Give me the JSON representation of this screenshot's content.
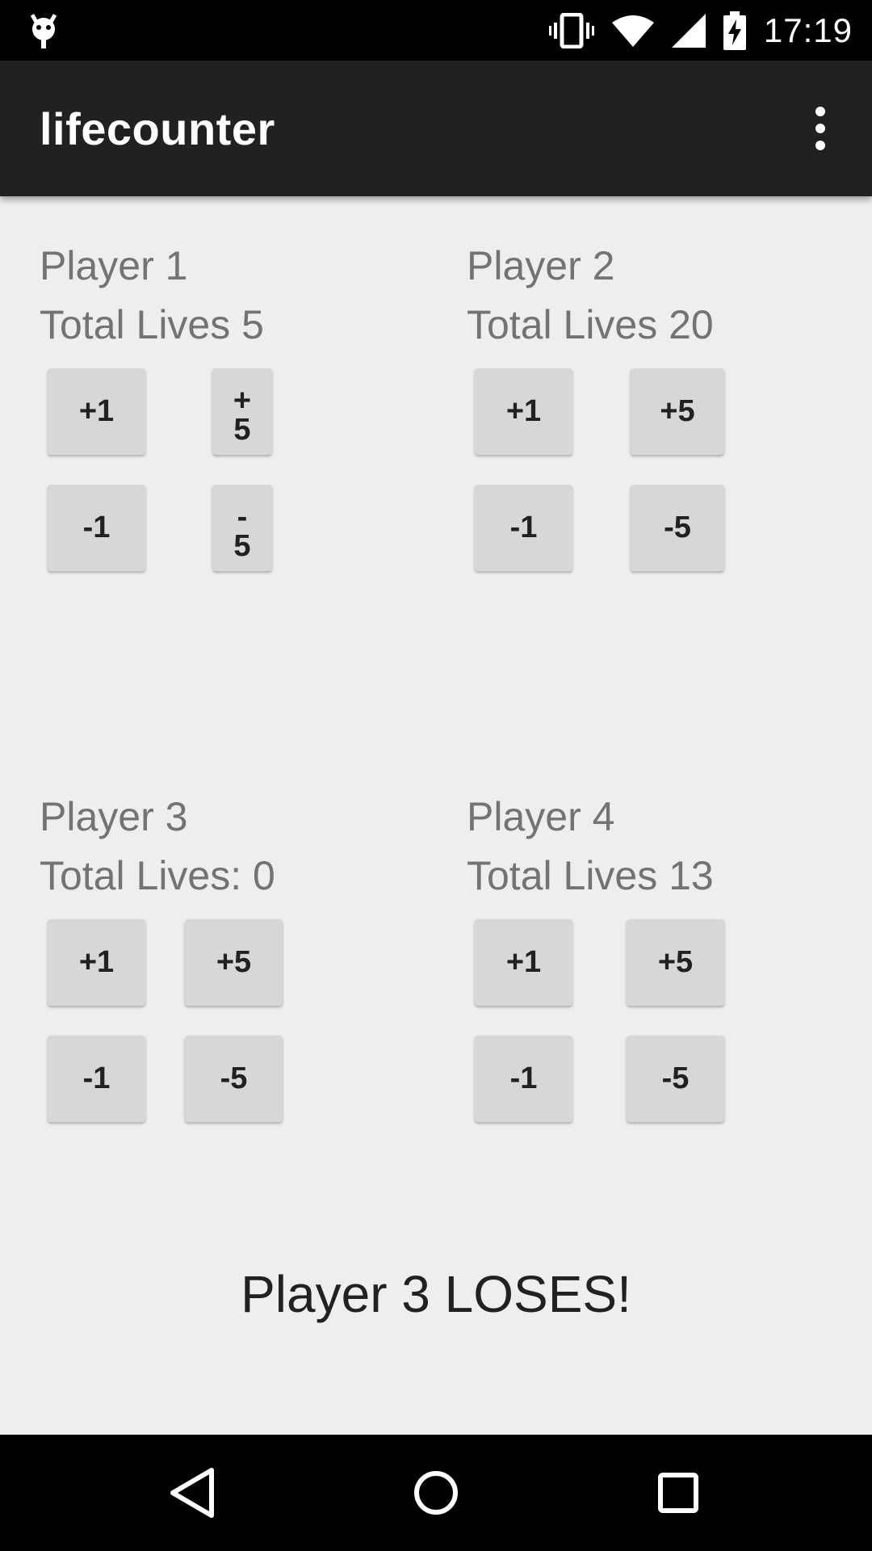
{
  "status_bar": {
    "time": "17:19",
    "icons": [
      "android-debug-icon",
      "vibrate-icon",
      "wifi-icon",
      "cell-signal-icon",
      "battery-charging-icon"
    ]
  },
  "app_bar": {
    "title": "lifecounter",
    "menu_icon": "overflow-menu-icon"
  },
  "players": [
    {
      "name": "Player 1",
      "lives_text": "Total Lives 5",
      "buttons": {
        "plus1": "+1",
        "plus5": "+5",
        "minus1": "-1",
        "minus5": "-5"
      }
    },
    {
      "name": "Player 2",
      "lives_text": "Total Lives 20",
      "buttons": {
        "plus1": "+1",
        "plus5": "+5",
        "minus1": "-1",
        "minus5": "-5"
      }
    },
    {
      "name": "Player 3",
      "lives_text": "Total Lives: 0",
      "buttons": {
        "plus1": "+1",
        "plus5": "+5",
        "minus1": "-1",
        "minus5": "-5"
      }
    },
    {
      "name": "Player 4",
      "lives_text": "Total Lives 13",
      "buttons": {
        "plus1": "+1",
        "plus5": "+5",
        "minus1": "-1",
        "minus5": "-5"
      }
    }
  ],
  "message": "Player 3 LOSES!",
  "nav_bar": {
    "icons": [
      "back-icon",
      "home-icon",
      "recents-icon"
    ]
  },
  "colors": {
    "background": "#eeeeee",
    "app_bar": "#212121",
    "button": "#d6d7d7",
    "secondary_text": "#737373"
  }
}
